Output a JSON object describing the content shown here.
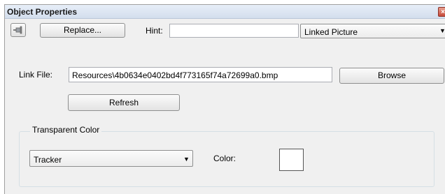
{
  "window": {
    "title": "Object Properties",
    "close_glyph": "×"
  },
  "toolbar": {
    "pin_icon": "pin-icon",
    "replace_label": "Replace...",
    "hint_label": "Hint:",
    "hint_value": "",
    "type_select": {
      "selected": "Linked Picture",
      "arrow": "▼"
    }
  },
  "link": {
    "label": "Link File:",
    "value": "Resources\\4b0634e0402bd4f773165f74a72699a0.bmp",
    "browse_label": "Browse",
    "refresh_label": "Refresh"
  },
  "transparent": {
    "group_title": "Transparent Color",
    "mode_select": {
      "selected": "Tracker",
      "arrow": "▼"
    },
    "color_label": "Color:",
    "color_value": "#ffffff"
  }
}
